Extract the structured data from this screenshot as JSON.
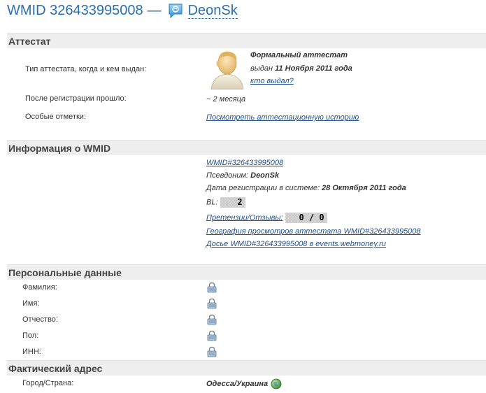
{
  "header": {
    "wmid": "WMID 326433995008",
    "separator": "—",
    "nickname": "DeonSk"
  },
  "attestat": {
    "section_title": "Аттестат",
    "type_label": "Тип аттестата, когда и кем выдан:",
    "type_value": "Формальный аттестат",
    "issued_prefix": "выдан",
    "issued_date": "11 Ноября 2011 года",
    "who_issued_link": "кто выдал?",
    "since_label": "После регистрации прошло:",
    "since_value": "~ 2 месяца",
    "notes_label": "Особые отметки:",
    "history_link": "Посмотреть аттестационную историю"
  },
  "wmid_info": {
    "section_title": "Информация о WMID",
    "wmid_link": "WMID#326433995008",
    "pseudonym_label": "Псевдоним:",
    "pseudonym_value": "DeonSk",
    "reg_label": "Дата регистрации в системе:",
    "reg_value": "28 Октября 2011 года",
    "bl_label": "BL:",
    "bl_value": "2",
    "claims_link": "Претензии/Отзывы:",
    "claims_value": "0 / 0",
    "geo_link": "География просмотров аттестата WMID#326433995008",
    "dossier_link": "Досье WMID#326433995008 в events.webmoney.ru"
  },
  "personal": {
    "section_title": "Персональные данные",
    "fields": [
      "Фамилия:",
      "Имя:",
      "Отчество:",
      "Пол:",
      "ИНН:"
    ],
    "locked_icon": "lock-icon"
  },
  "address": {
    "section_title": "Фактический адрес",
    "city_label": "Город/Страна:",
    "city_value": "Одесса/Украина",
    "globe_icon": "globe-icon"
  },
  "colors": {
    "link": "#1f4f8f",
    "title": "#2a6fb0",
    "section_bg": "#eeeeee"
  }
}
